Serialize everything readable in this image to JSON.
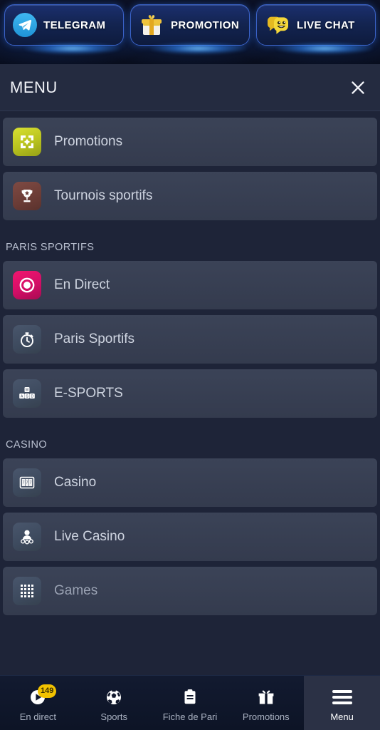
{
  "topbar": {
    "buttons": [
      {
        "label": "TELEGRAM",
        "icon": "telegram-icon"
      },
      {
        "label": "PROMOTION",
        "icon": "gift-box-icon"
      },
      {
        "label": "LIVE CHAT",
        "icon": "chat-smiley-icon"
      }
    ]
  },
  "menu": {
    "title": "MENU",
    "close_icon": "close-icon",
    "top_items": [
      {
        "label": "Promotions",
        "icon": "promotions-gift-icon",
        "icon_style": "ic-promo"
      },
      {
        "label": "Tournois sportifs",
        "icon": "trophy-icon",
        "icon_style": "ic-trophy"
      }
    ],
    "sections": [
      {
        "label": "PARIS SPORTIFS",
        "items": [
          {
            "label": "En Direct",
            "icon": "live-dot-icon",
            "icon_style": "ic-live"
          },
          {
            "label": "Paris Sportifs",
            "icon": "stopwatch-icon",
            "icon_style": "ic-dark"
          },
          {
            "label": "E-SPORTS",
            "icon": "wasd-keys-icon",
            "icon_style": "ic-dark"
          }
        ]
      },
      {
        "label": "CASINO",
        "items": [
          {
            "label": "Casino",
            "icon": "slot-machine-icon",
            "icon_style": "ic-dark"
          },
          {
            "label": "Live Casino",
            "icon": "live-dealer-icon",
            "icon_style": "ic-dark"
          },
          {
            "label": "Games",
            "icon": "grid-games-icon",
            "icon_style": "ic-dark"
          }
        ]
      }
    ]
  },
  "bottom_nav": {
    "items": [
      {
        "label": "En direct",
        "icon": "play-circle-icon",
        "badge": "149",
        "active": false
      },
      {
        "label": "Sports",
        "icon": "soccer-ball-icon",
        "badge": "",
        "active": false
      },
      {
        "label": "Fiche de Pari",
        "icon": "clipboard-icon",
        "badge": "",
        "active": false
      },
      {
        "label": "Promotions",
        "icon": "gift-icon",
        "badge": "",
        "active": false
      },
      {
        "label": "Menu",
        "icon": "hamburger-icon",
        "badge": "",
        "active": true
      }
    ]
  },
  "colors": {
    "page_bg": "#1e2438",
    "row_bg": "#3b4357",
    "header_bg": "#242b40",
    "accent_blue": "#3b63c9",
    "accent_pink": "#f0166f",
    "accent_yellow": "#d8e033",
    "badge_yellow": "#f2c200"
  }
}
